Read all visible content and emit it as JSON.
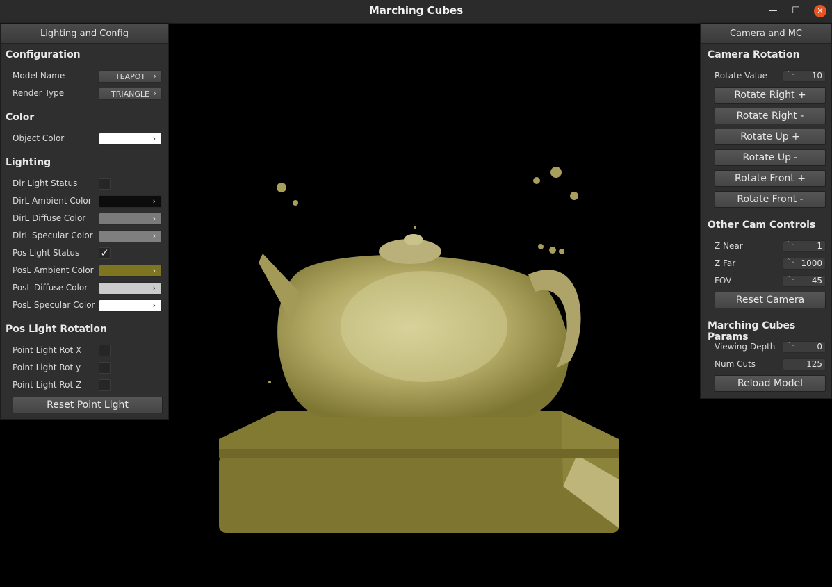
{
  "window": {
    "title": "Marching Cubes",
    "minimize_glyph": "—",
    "maximize_glyph": "☐",
    "close_glyph": "✕"
  },
  "colors": {
    "accent_close": "#e95420",
    "model_color": "#8a8040",
    "model_highlight": "#d8d29a"
  },
  "left_panel": {
    "header": "Lighting and Config",
    "configuration": {
      "title": "Configuration",
      "model_name_label": "Model Name",
      "model_name_value": "TEAPOT",
      "render_type_label": "Render Type",
      "render_type_value": "TRIANGLE"
    },
    "color": {
      "title": "Color",
      "object_color_label": "Object Color",
      "object_color": "#ffffff"
    },
    "lighting": {
      "title": "Lighting",
      "dir_light_status_label": "Dir Light Status",
      "dir_light_status": false,
      "dirl_ambient_label": "DirL Ambient Color",
      "dirl_ambient": "#0c0c0c",
      "dirl_diffuse_label": "DirL Diffuse Color",
      "dirl_diffuse": "#7a7a7a",
      "dirl_specular_label": "DirL Specular Color",
      "dirl_specular": "#7f7f7f",
      "pos_light_status_label": "Pos Light Status",
      "pos_light_status": true,
      "posl_ambient_label": "PosL Ambient Color",
      "posl_ambient": "#7d7520",
      "posl_diffuse_label": "PosL Diffuse Color",
      "posl_diffuse": "#cccccc",
      "posl_specular_label": "PosL Specular Color",
      "posl_specular": "#ffffff"
    },
    "pos_light_rotation": {
      "title": "Pos Light Rotation",
      "rot_x_label": "Point Light Rot X",
      "rot_y_label": "Point Light Rot y",
      "rot_z_label": "Point Light Rot Z",
      "reset_label": "Reset Point Light"
    },
    "checkmark": "✓",
    "chevron": "›"
  },
  "right_panel": {
    "header": "Camera and MC",
    "camera_rotation": {
      "title": "Camera Rotation",
      "rotate_value_label": "Rotate Value",
      "rotate_value": "10",
      "rotate_right_plus": "Rotate Right +",
      "rotate_right_minus": "Rotate Right -",
      "rotate_up_plus": "Rotate Up +",
      "rotate_up_minus": "Rotate Up -",
      "rotate_front_plus": "Rotate Front +",
      "rotate_front_minus": "Rotate Front -"
    },
    "other_cam": {
      "title": "Other Cam Controls",
      "z_near_label": "Z Near",
      "z_near": "1",
      "z_far_label": "Z Far",
      "z_far": "1000",
      "fov_label": "FOV",
      "fov": "45",
      "reset_camera": "Reset Camera"
    },
    "mc_params": {
      "title": "Marching Cubes Params",
      "viewing_depth_label": "Viewing Depth",
      "viewing_depth": "0",
      "num_cuts_label": "Num Cuts",
      "num_cuts": "125",
      "reload_model": "Reload Model"
    },
    "spin_arrows": "⌃⌄"
  }
}
